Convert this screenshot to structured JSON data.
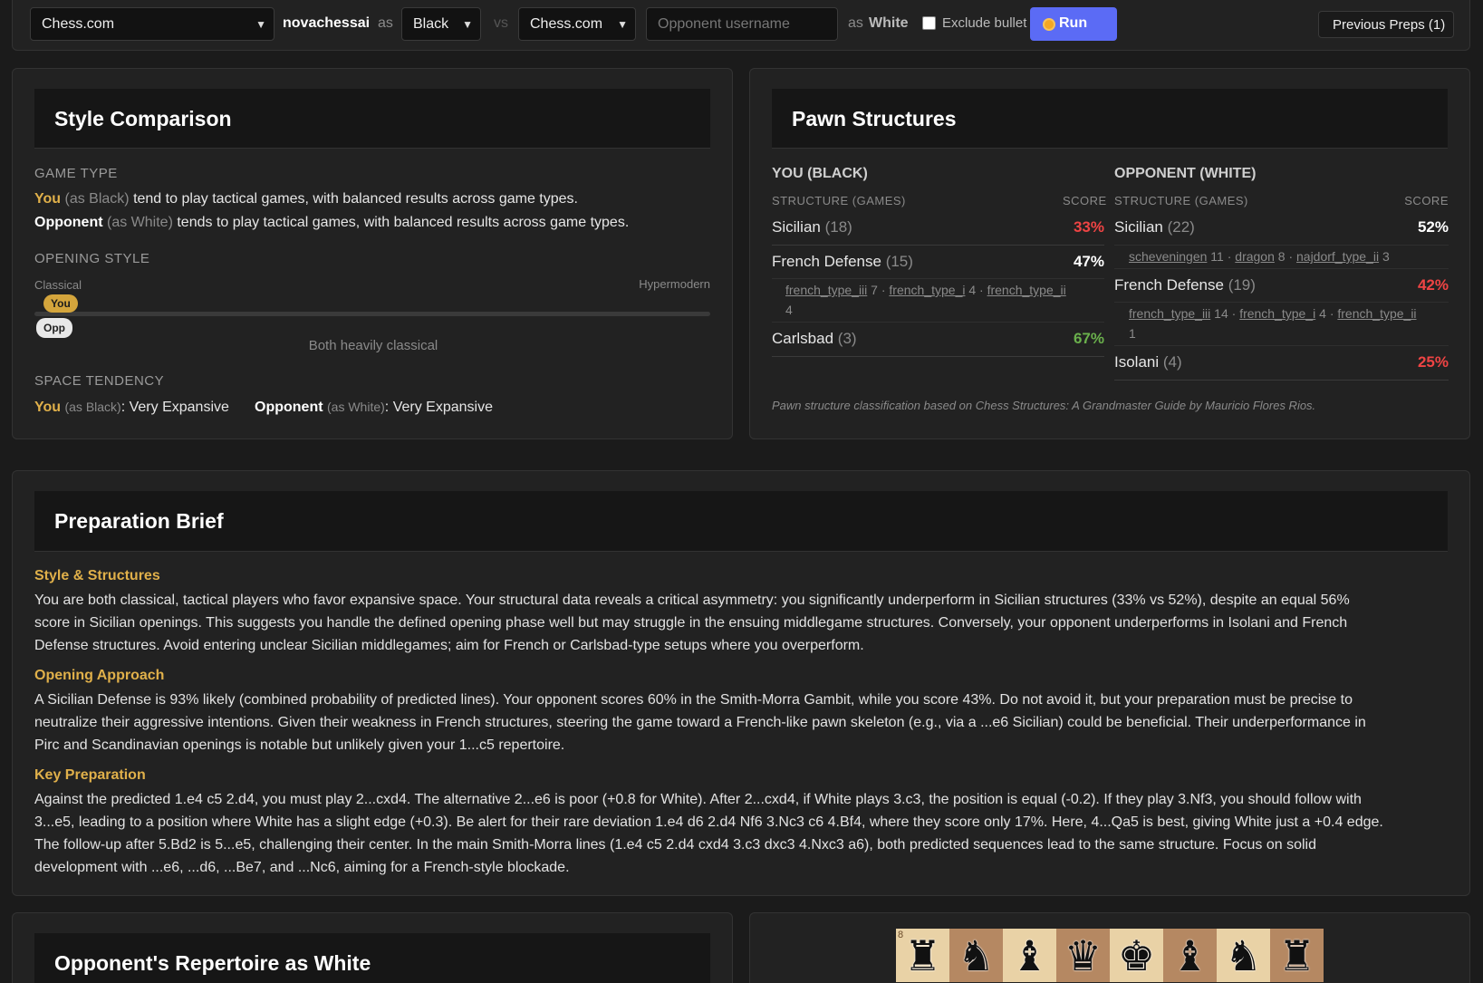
{
  "topbar": {
    "platform_select": "Chess.com",
    "username": "novachessai",
    "as_text_1": "as",
    "color_select": "Black",
    "vs_text": "vs",
    "opponent_platform_select": "Chess.com",
    "opponent_placeholder": "Opponent username",
    "as_text_2": "as",
    "opponent_color": "White",
    "exclude_bullet_label": "Exclude bullet",
    "run_label": "Run",
    "previous_preps_label": "Previous Preps (1)"
  },
  "style": {
    "title": "Style Comparison",
    "game_type_label": "GAME TYPE",
    "you": "You",
    "as_black": "(as Black)",
    "you_game_type_text": "tend to play tactical games, with balanced results across game types.",
    "opponent": "Opponent",
    "as_white": "(as White)",
    "opp_game_type_text": "tends to play tactical games, with balanced results across game types.",
    "opening_style_label": "OPENING STYLE",
    "classical": "Classical",
    "hypermodern": "Hypermodern",
    "you_pill": "You",
    "opp_pill": "Opp",
    "opening_summary": "Both heavily classical",
    "space_label": "SPACE TENDENCY",
    "you_space_as": "(as Black)",
    "you_space_value": ": Very Expansive",
    "opp_space_as": "(as White)",
    "opp_space_value": ": Very Expansive"
  },
  "pawn": {
    "title": "Pawn Structures",
    "you_header": "YOU (BLACK)",
    "opp_header": "OPPONENT (WHITE)",
    "col_structure": "STRUCTURE (GAMES)",
    "col_score": "SCORE",
    "you_rows": [
      {
        "name": "Sicilian",
        "games": "(18)",
        "score": "33%"
      },
      {
        "name": "French Defense",
        "games": "(15)",
        "score": "47%"
      },
      {
        "name": "Carlsbad",
        "games": "(3)",
        "score": "67%"
      }
    ],
    "you_french_sub": {
      "a": "french_type_iii",
      "a_n": "7 ·",
      "b": "french_type_i",
      "b_n": "4 ·",
      "c": "french_type_ii",
      "c_n": "4"
    },
    "opp_rows": [
      {
        "name": "Sicilian",
        "games": "(22)",
        "score": "52%"
      },
      {
        "name": "French Defense",
        "games": "(19)",
        "score": "42%"
      },
      {
        "name": "Isolani",
        "games": "(4)",
        "score": "25%"
      }
    ],
    "opp_sicilian_sub": {
      "a": "scheveningen",
      "a_n": "11 ·",
      "b": "dragon",
      "b_n": "8 ·",
      "c": "najdorf_type_ii",
      "c_n": "3"
    },
    "opp_french_sub": {
      "a": "french_type_iii",
      "a_n": "14 ·",
      "b": "french_type_i",
      "b_n": "4 ·",
      "c": "french_type_ii",
      "c_n": "1"
    },
    "footnote": "Pawn structure classification based on Chess Structures: A Grandmaster Guide by Mauricio Flores Rios."
  },
  "brief": {
    "title": "Preparation Brief",
    "s1_title": "Style & Structures",
    "s1_p1": "You are both classical, tactical players who favor expansive space. Your structural data reveals a critical asymmetry: you significantly underperform in Sicilian structures (33% vs 52%), despite an equal 56%",
    "s1_p2": "score in Sicilian openings. This suggests you handle the defined opening phase well but may struggle in the ensuing middlegame structures. Conversely, your opponent underperforms in Isolani and French",
    "s1_p3": "Defense structures. Avoid entering unclear Sicilian middlegames; aim for French or Carlsbad-type setups where you overperform.",
    "s2_title": "Opening Approach",
    "s2_p1": "A Sicilian Defense is 93% likely (combined probability of predicted lines). Your opponent scores 60% in the Smith-Morra Gambit, while you score 43%. Do not avoid it, but your preparation must be precise to",
    "s2_p2": "neutralize their aggressive intentions. Given their weakness in French structures, steering the game toward a French-like pawn skeleton (e.g., via a ...e6 Sicilian) could be beneficial. Their underperformance in",
    "s2_p3": "Pirc and Scandinavian openings is notable but unlikely given your 1...c5 repertoire.",
    "s3_title": "Key Preparation",
    "s3_p1": "Against the predicted 1.e4 c5 2.d4, you must play 2...cxd4. The alternative 2...e6 is poor (+0.8 for White). After 2...cxd4, if White plays 3.c3, the position is equal (-0.2). If they play 3.Nf3, you should follow with",
    "s3_p2": "3...e5, leading to a position where White has a slight edge (+0.3). Be alert for their rare deviation 1.e4 d6 2.d4 Nf6 3.Nc3 c6 4.Bf4, where they score only 17%. Here, 4...Qa5 is best, giving White just a +0.4 edge.",
    "s3_p3": "The follow-up after 5.Bd2 is 5...e5, challenging their center. In the main Smith-Morra lines (1.e4 c5 2.d4 cxd4 3.c3 dxc3 4.Nxc3 a6), both predicted sequences lead to the same structure. Focus on solid",
    "s3_p4": "development with ...e6, ...d6, ...Be7, and ...Nc6, aiming for a French-style blockade."
  },
  "repertoire": {
    "title": "Opponent's Repertoire as White"
  },
  "board": {
    "rank_label": "8",
    "pieces": [
      "♜",
      "♞",
      "♝",
      "♛",
      "♚",
      "♝",
      "♞",
      "♜"
    ]
  }
}
